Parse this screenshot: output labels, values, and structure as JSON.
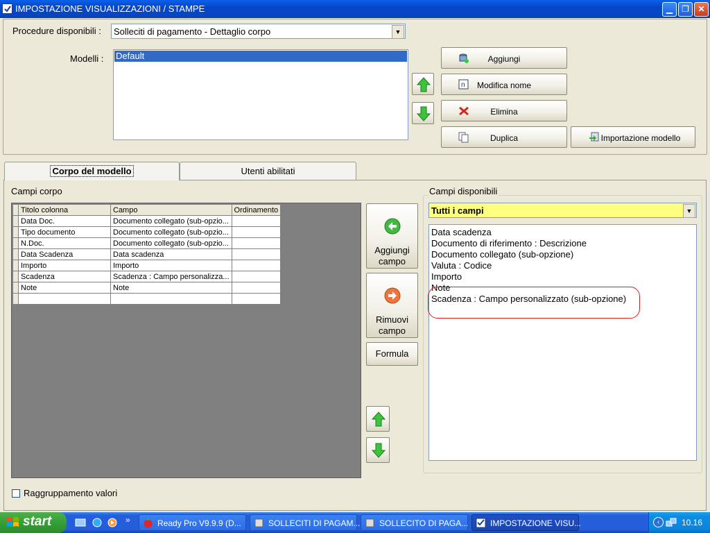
{
  "window": {
    "title": "IMPOSTAZIONE VISUALIZZAZIONI / STAMPE"
  },
  "top": {
    "procedure_label": "Procedure disponibili :",
    "procedure_value": "Solleciti di pagamento - Dettaglio corpo",
    "modelli_label": "Modelli :",
    "models": [
      "Default"
    ],
    "buttons": {
      "aggiungi": "Aggiungi",
      "modifica_nome": "Modifica nome",
      "elimina": "Elimina",
      "duplica": "Duplica",
      "importazione": "Importazione modello"
    }
  },
  "tabs": {
    "corpo": "Corpo del modello",
    "utenti": "Utenti abilitati"
  },
  "campi_corpo": {
    "label": "Campi corpo",
    "columns": [
      "Titolo colonna",
      "Campo",
      "Ordinamento"
    ],
    "rows": [
      [
        "Data Doc.",
        "Documento collegato (sub-opzio...",
        ""
      ],
      [
        "Tipo documento",
        "Documento collegato (sub-opzio...",
        ""
      ],
      [
        "N.Doc.",
        "Documento collegato (sub-opzio...",
        ""
      ],
      [
        "Data Scadenza",
        "Data scadenza",
        ""
      ],
      [
        "Importo",
        "Importo",
        ""
      ],
      [
        "Scadenza",
        "Scadenza : Campo personalizza...",
        ""
      ],
      [
        "Note",
        "Note",
        ""
      ],
      [
        "",
        "",
        ""
      ]
    ]
  },
  "side_buttons": {
    "aggiungi_campo_1": "Aggiungi",
    "aggiungi_campo_2": "campo",
    "rimuovi_campo_1": "Rimuovi",
    "rimuovi_campo_2": "campo",
    "formula": "Formula"
  },
  "campi_disponibili": {
    "label": "Campi disponibili",
    "filter": "Tutti i campi",
    "items": [
      "Data scadenza",
      "Documento di riferimento : Descrizione",
      "Documento collegato (sub-opzione)",
      "Valuta : Codice",
      "Importo",
      "Note",
      "Scadenza : Campo personalizzato (sub-opzione)"
    ]
  },
  "raggruppamento_label": "Raggruppamento valori",
  "taskbar": {
    "start": "start",
    "tasks": [
      "Ready Pro V9.9.9 (D...",
      "SOLLECITI DI PAGAM...",
      "SOLLECITO DI PAGA...",
      "IMPOSTAZIONE VISU..."
    ],
    "clock": "10.16"
  },
  "colors": {
    "highlight": "#E02020",
    "filter_bg": "#FFFF80",
    "selection": "#316AC5"
  }
}
